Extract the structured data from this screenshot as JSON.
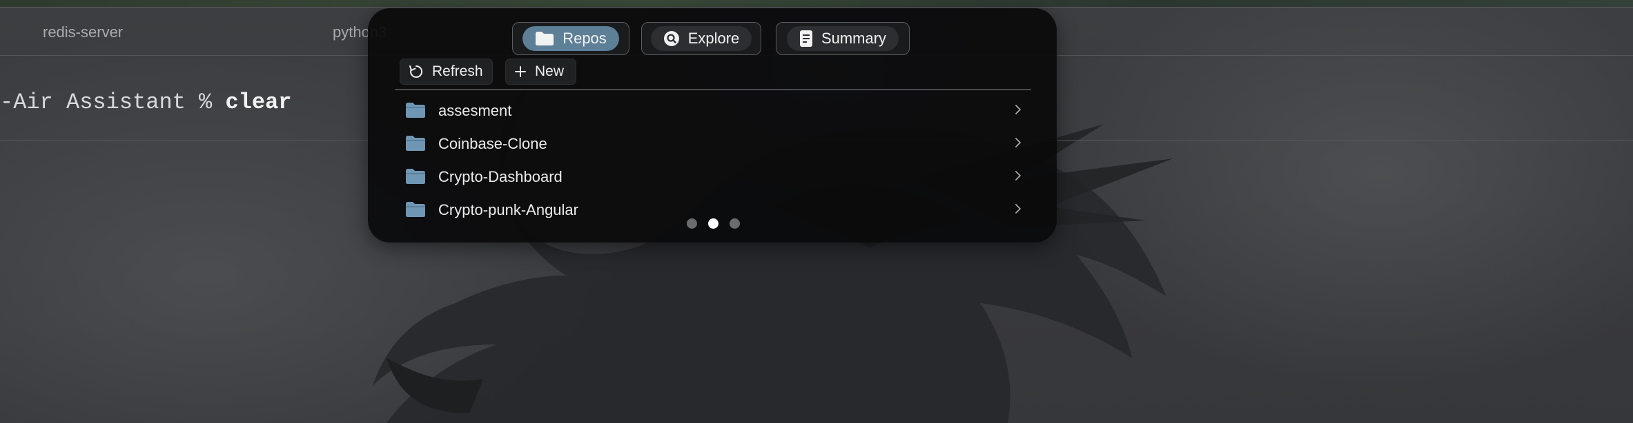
{
  "terminal": {
    "tabs": [
      "redis-server",
      "python3"
    ],
    "prompt": "-Air Assistant % ",
    "command": "clear"
  },
  "panel": {
    "segments": [
      {
        "label": "Repos",
        "icon": "folder-icon",
        "active": true
      },
      {
        "label": "Explore",
        "icon": "search-icon",
        "active": false
      },
      {
        "label": "Summary",
        "icon": "document-icon",
        "active": false
      }
    ],
    "toolbar": {
      "refresh_label": "Refresh",
      "new_label": "New"
    },
    "repos": [
      "assesment",
      "Coinbase-Clone",
      "Crypto-Dashboard",
      "Crypto-punk-Angular"
    ],
    "page_indicator": {
      "pages": 3,
      "current": 2
    },
    "colors": {
      "accent": "#5d7f98",
      "folder": "#6f97b5",
      "panel_bg": "#0a0a0b"
    }
  }
}
